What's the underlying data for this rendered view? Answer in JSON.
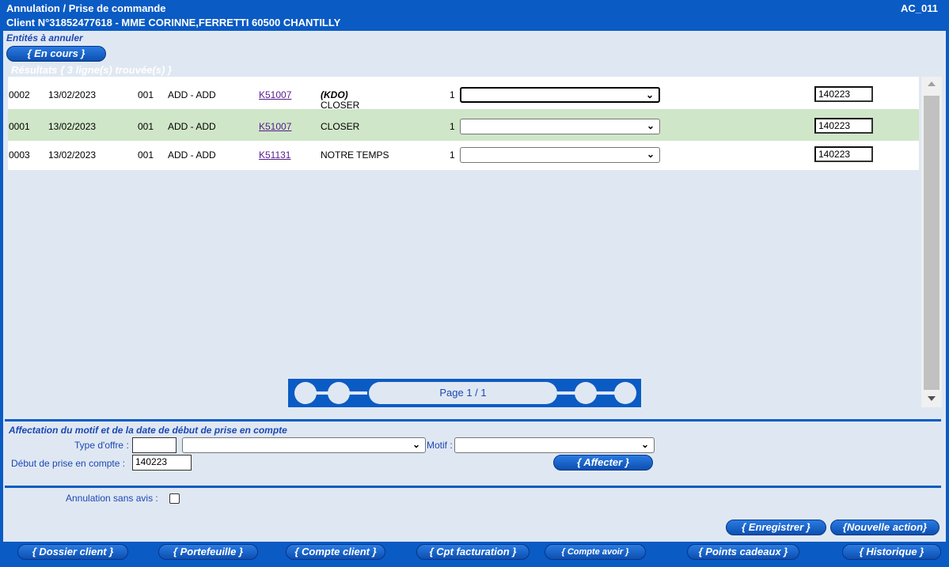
{
  "header": {
    "title": "Annulation / Prise de commande",
    "client": "Client N°31852477618 - MME CORINNE,FERRETTI 60500 CHANTILLY",
    "screen_code": "AC_011"
  },
  "entities": {
    "section_title": "Entités à annuler",
    "tab_label": "{   En cours   }"
  },
  "results": {
    "title": "Résultats { 3 ligne(s) trouvée(s) }",
    "rows": [
      {
        "num": "0002",
        "date": "13/02/2023",
        "code": "001",
        "type": "ADD - ADD",
        "ref": "K51007",
        "title_italic": "(KDO)",
        "title": "CLOSER",
        "qty": "1",
        "motif": "",
        "start": "140223"
      },
      {
        "num": "0001",
        "date": "13/02/2023",
        "code": "001",
        "type": "ADD - ADD",
        "ref": "K51007",
        "title_italic": "",
        "title": "CLOSER",
        "qty": "1",
        "motif": "",
        "start": "140223"
      },
      {
        "num": "0003",
        "date": "13/02/2023",
        "code": "001",
        "type": "ADD - ADD",
        "ref": "K51131",
        "title_italic": "",
        "title": "NOTRE TEMPS",
        "qty": "1",
        "motif": "",
        "start": "140223"
      }
    ],
    "pager_label": "Page 1 / 1"
  },
  "assign": {
    "section_title": "Affectation du motif et de la date de début de prise en compte",
    "offer_type_label": "Type d'offre :",
    "offer_type_value": "",
    "offer_select_value": "",
    "motif_label": "Motif :",
    "motif_value": "",
    "start_label": "Début de prise en compte :",
    "start_value": "140223",
    "assign_button": "{   Affecter   }"
  },
  "options": {
    "no_notice_label": "Annulation sans avis :",
    "no_notice_checked": false
  },
  "actions": {
    "save": "{ Enregistrer }",
    "new_action": "{Nouvelle action}"
  },
  "nav": [
    {
      "label": "{ Dossier client }"
    },
    {
      "label": "{ Portefeuille }"
    },
    {
      "label": "{ Compte client }"
    },
    {
      "label": "{ Cpt facturation }"
    },
    {
      "label": "{ Compte avoir }"
    },
    {
      "label": "{ Points cadeaux }"
    },
    {
      "label": "{ Historique }"
    }
  ],
  "colors": {
    "brand_blue": "#0a5bc4",
    "panel_bg": "#dfe8f2",
    "label_blue": "#1e47b4",
    "selected_row": "#cfe6c8"
  }
}
